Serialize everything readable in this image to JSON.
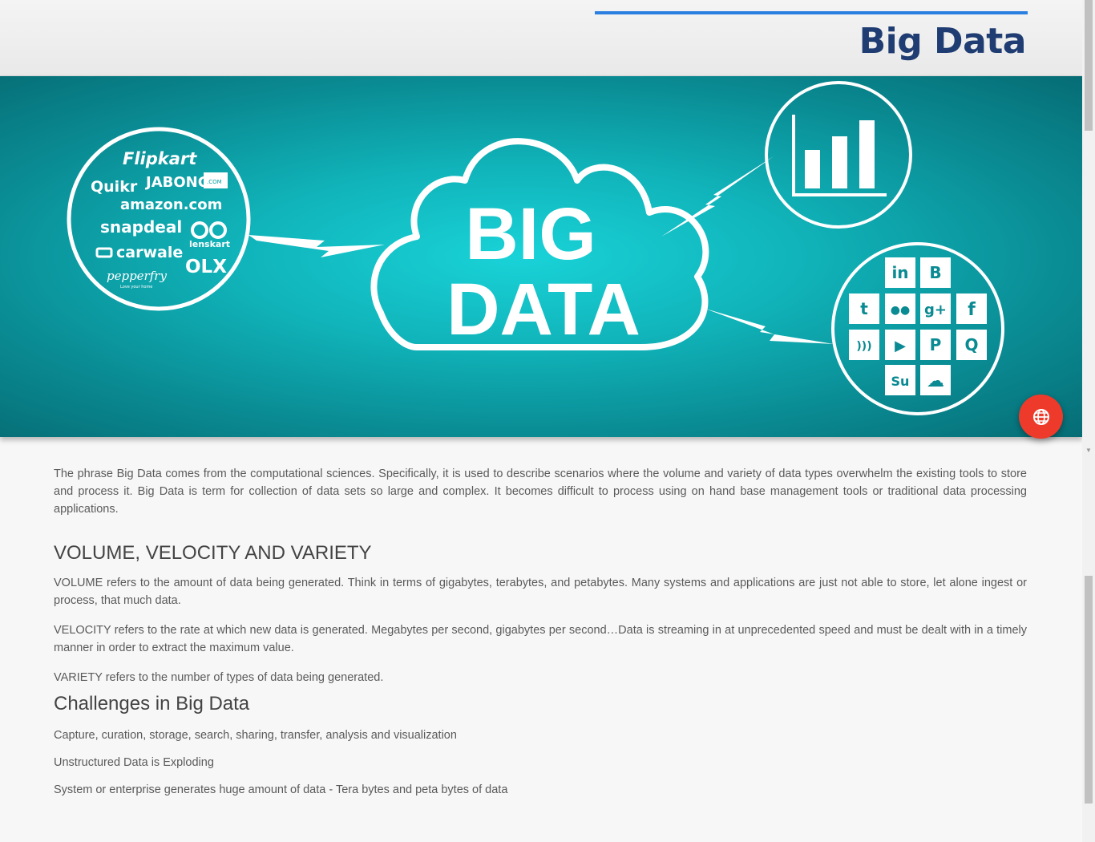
{
  "header": {
    "title": "Big Data"
  },
  "hero": {
    "cloud_line1": "BIG",
    "cloud_line2": "DATA",
    "brands": [
      "Flipkart",
      "Quikr",
      "JABONG",
      ".COM",
      "amazon.com",
      "snapdeal",
      "lenskart",
      "carwale",
      "OLX",
      "pepperfry",
      "Love your home"
    ],
    "social_icons": [
      "linkedin-icon",
      "blogger-icon",
      "twitter-icon",
      "flickr-icon",
      "google-plus-icon",
      "facebook-icon",
      "rss-icon",
      "youtube-icon",
      "pinterest-icon",
      "quora-icon",
      "stumbleupon-icon",
      "soundcloud-icon"
    ],
    "social_glyphs": {
      "linkedin": "in",
      "blogger": "B",
      "twitter": "t",
      "flickr": "●●",
      "gplus": "g+",
      "facebook": "f",
      "rss": ")))",
      "youtube": "▶",
      "pinterest": "P",
      "quora": "Q",
      "stumbleupon": "Su",
      "soundcloud": "☁"
    },
    "colors": {
      "teal_center": "#19d3d8",
      "teal_edge": "#066c74"
    }
  },
  "fab": {
    "icon": "globe-icon",
    "color": "#ee3a2b"
  },
  "content": {
    "intro": "The phrase Big Data comes from the computational sciences. Specifically, it is used to describe scenarios where the volume and variety of data types overwhelm the existing tools to store and process it. Big Data is term for collection of data sets so large and complex. It becomes difficult to process using on hand base management tools or traditional data processing applications.",
    "section1": {
      "heading": "VOLUME, VELOCITY AND VARIETY",
      "volume": "VOLUME refers to the amount of data being generated. Think in terms of gigabytes, terabytes, and petabytes. Many systems and applications are just not able to store, let alone ingest or process, that much data.",
      "velocity": "VELOCITY refers to the rate at which new data is generated. Megabytes per second, gigabytes per second…Data is streaming in at unprecedented speed and must be dealt with in a timely manner in order to extract the maximum value.",
      "variety": "VARIETY refers to the number of types of data being generated."
    },
    "section2": {
      "heading": "Challenges in Big Data",
      "items": [
        "Capture, curation, storage, search, sharing, transfer, analysis and visualization",
        "Unstructured Data is Exploding",
        "System or enterprise generates huge amount of data - Tera bytes and peta bytes of data"
      ]
    }
  }
}
